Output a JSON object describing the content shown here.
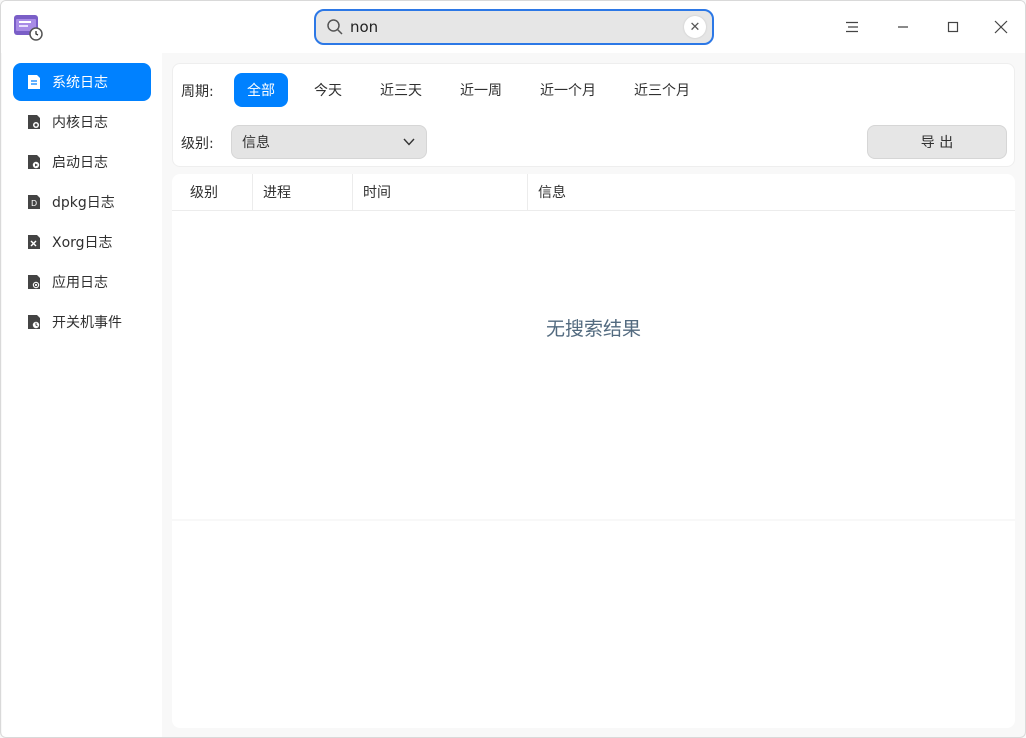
{
  "search": {
    "value": "non"
  },
  "sidebar": {
    "items": [
      {
        "label": "系统日志",
        "icon": "document-icon"
      },
      {
        "label": "内核日志",
        "icon": "kernel-log-icon"
      },
      {
        "label": "启动日志",
        "icon": "boot-log-icon"
      },
      {
        "label": "dpkg日志",
        "icon": "dpkg-log-icon"
      },
      {
        "label": "Xorg日志",
        "icon": "xorg-log-icon"
      },
      {
        "label": "应用日志",
        "icon": "app-log-icon"
      },
      {
        "label": "开关机事件",
        "icon": "power-event-icon"
      }
    ]
  },
  "filters": {
    "period_label": "周期:",
    "periods": [
      "全部",
      "今天",
      "近三天",
      "近一周",
      "近一个月",
      "近三个月"
    ],
    "level_label": "级别:",
    "level_value": "信息",
    "export_label": "导 出"
  },
  "table": {
    "columns": [
      "级别",
      "进程",
      "时间",
      "信息"
    ],
    "empty_message": "无搜索结果"
  },
  "colors": {
    "accent": "#0081ff",
    "search_border": "#2c78e6"
  }
}
